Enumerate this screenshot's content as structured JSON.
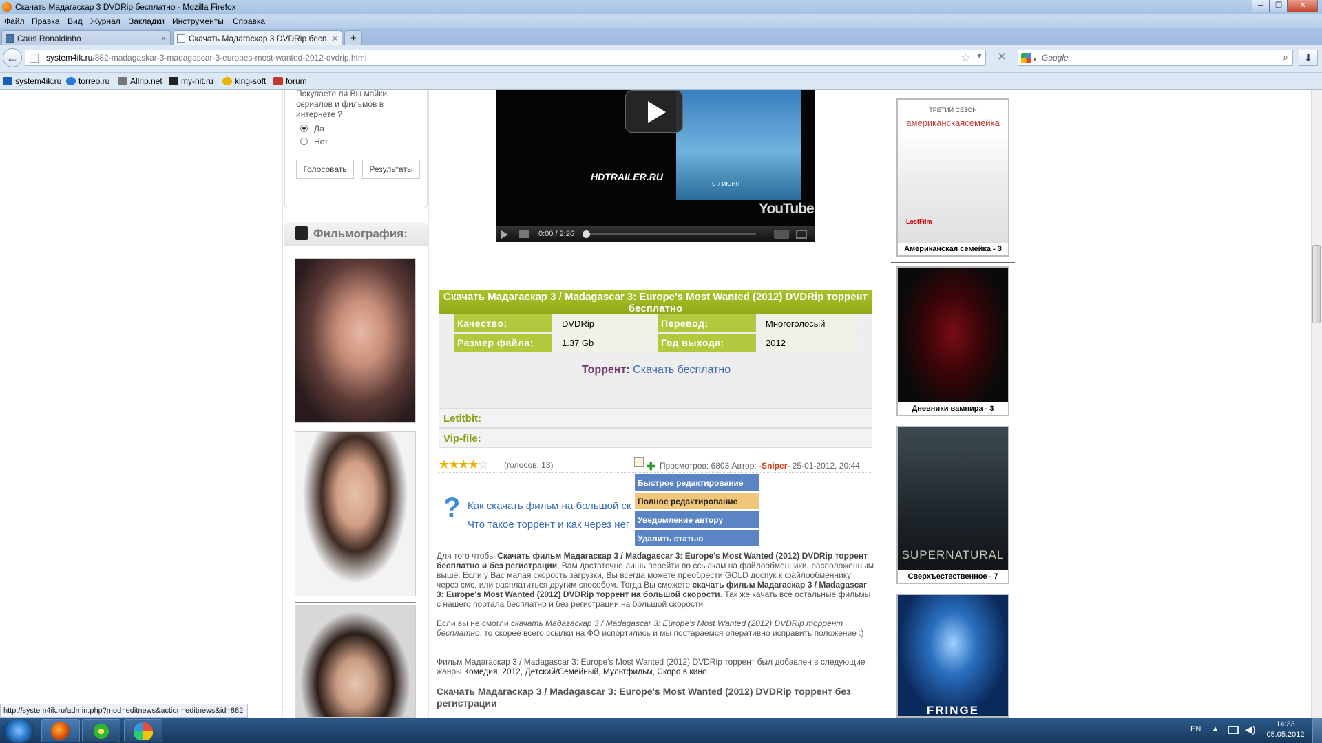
{
  "window": {
    "title": "Скачать Мадагаскар 3 DVDRip бесплатно - Mozilla Firefox",
    "controls": [
      "─",
      "❐",
      "✕"
    ]
  },
  "menu": [
    "Файл",
    "Правка",
    "Вид",
    "Журнал",
    "Закладки",
    "Инструменты",
    "Справка"
  ],
  "tabs": [
    {
      "label": "Саня Ronaldinho",
      "close": "×"
    },
    {
      "label": "Скачать Мадагаскар 3 DVDRip бесп...",
      "close": "×"
    }
  ],
  "new_tab": "+",
  "address": {
    "domain": "system4ik.ru",
    "path": "/882-madagaskar-3-madagascar-3-europes-most-wanted-2012-dvdrip.html"
  },
  "search": {
    "placeholder": "Google"
  },
  "bookmarks": [
    {
      "label": "system4ik.ru",
      "color": "#1a5fb4"
    },
    {
      "label": "torreo.ru",
      "color": "#2a7bd8"
    },
    {
      "label": "Allrip.net",
      "color": "#444444"
    },
    {
      "label": "my-hit.ru",
      "color": "#222222"
    },
    {
      "label": "king-soft",
      "color": "#e8b400"
    },
    {
      "label": "forum",
      "color": "#c0392b"
    }
  ],
  "poll": {
    "question": "Покупаете ли Вы майки сериалов и фильмов в интернете ?",
    "options": [
      "Да",
      "Нет"
    ],
    "vote_button": "Голосовать",
    "results_button": "Результаты"
  },
  "filmography": {
    "title": "Фильмография:",
    "photos": [
      "actress-photo",
      "actor-photo-1",
      "actor-photo-2"
    ]
  },
  "video": {
    "time": "0:00 / 2:26",
    "brand": "HDTRAILER.RU",
    "youtube": "YouTube",
    "date_text": "С 7 ИЮНЯ"
  },
  "article": {
    "title": "Скачать Мадагаскар 3 / Madagascar 3: Europe's Most Wanted (2012) DVDRip торрент бесплатно",
    "details": {
      "quality_label": "Качество:",
      "quality_value": "DVDRip",
      "translation_label": "Перевод:",
      "translation_value": "Многоголосый",
      "size_label": "Размер файла:",
      "size_value": "1.37 Gb",
      "year_label": "Год выхода:",
      "year_value": "2012"
    },
    "torrent_label": "Торрент:",
    "torrent_link": "Скачать бесплатно",
    "letitbit": "Letitbit:",
    "vipfile": "Vip-file:",
    "rating": {
      "stars": 4,
      "max": 5,
      "votes": "(голосов: 13)"
    },
    "meta": {
      "views_label": "Просмотров: 6803 Автор:",
      "author": "-Sniper-",
      "date": "25-01-2012, 20:44"
    },
    "help_links": [
      "Как скачать фильм на большой ск",
      "Что такое торрент и как через нег"
    ],
    "p1_a": "Для того чтобы ",
    "p1_b": "Скачать фильм Мадагаскар 3 / Madagascar 3: Europe's Most Wanted (2012) DVDRip торрент бесплатно и без регистрации",
    "p1_c": ", Вам достаточно лишь перейти по ссылкам на файлообменники, расположенным выше. Если у Вас малая скорость загрузки, Вы всегда можете преобрести GOLD доспук к файлообменнику через смс, или расплатиться другим способом. Тогда Вы сможете ",
    "p1_d": "скачать фильм Мадагаскар 3 / Madagascar 3: Europe's Most Wanted (2012) DVDRip торрент на большой скорости",
    "p1_e": ". Так же качать все остальные фильмы с нашего портала бесплатно и без регистрации на большой скорости",
    "p2_a": "Если вы не смогли ",
    "p2_b": "скачать Мадагаскар 3 / Madagascar 3: Europe's Most Wanted (2012) DVDRip торрент бесплатно",
    "p2_c": ", то скорее всего ссылки на ФО испортились и мы постараемся оперативно исправить положение :)",
    "p3_a": "Фильм Мадагаскар 3 / Madagascar 3: Europe's Most Wanted (2012) DVDRip торрент был добавлен в следующие жанры ",
    "p3_b": "Комедия, 2012, Детский/Семейный, Мультфильм, Скоро в кино",
    "subtitle": "Скачать Мадагаскар 3 / Madagascar 3: Europe's Most Wanted (2012) DVDRip торрент без регистрации"
  },
  "context_menu": [
    "Быстрое редактирование",
    "Полное редактирование",
    "Уведомление автору",
    "Удалить статью"
  ],
  "posters": [
    {
      "caption": "Американская семейка - 3",
      "top_text": "ТРЕТИЙ СЕЗОН",
      "title_text": "американскаясемейка",
      "logo": "LostFilm"
    },
    {
      "caption": "Дневники вампира - 3"
    },
    {
      "caption": "Сверхъестественное - 7",
      "title_text": "SUPERNATURAL"
    },
    {
      "caption": "",
      "title_text": "FRINGE"
    }
  ],
  "status_url": "http://system4ik.ru/admin.php?mod=editnews&action=editnews&id=882",
  "taskbar": {
    "lang": "EN",
    "time": "14:33",
    "date": "05.05.2012"
  },
  "colors": {
    "accent_green": "#8aa115",
    "title_bar_green": "#9bb524",
    "link_blue": "#3a6db5",
    "menu_blue": "#5a84c4",
    "menu_highlight": "#f0c77a",
    "author_red": "#d03a1a"
  }
}
